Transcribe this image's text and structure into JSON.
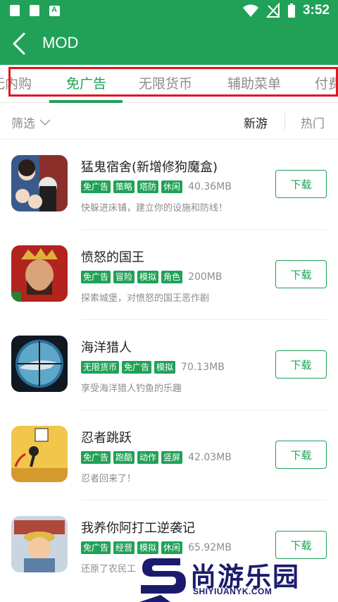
{
  "status_bar": {
    "time": "3:52",
    "left_icons": [
      "lock-icon",
      "map-icon",
      "a-app-icon"
    ],
    "right_icons": [
      "wifi-icon",
      "no-signal-icon",
      "battery-icon"
    ]
  },
  "app_bar": {
    "title": "MOD",
    "back_icon": "back-arrow-icon"
  },
  "tabs": [
    {
      "label": "无内购",
      "active": false
    },
    {
      "label": "免广告",
      "active": true
    },
    {
      "label": "无限货币",
      "active": false
    },
    {
      "label": "辅助菜单",
      "active": false
    },
    {
      "label": "付费",
      "active": false
    }
  ],
  "filter": {
    "label": "筛选",
    "sort_new": "新游",
    "sort_hot": "热门"
  },
  "apps": [
    {
      "name": "猛鬼宿舍(新增修狗魔盒)",
      "tags": [
        "免广告",
        "策略",
        "塔防",
        "休闲"
      ],
      "size": "40.36MB",
      "desc": "快躲进床铺，建立你的设施和防线！",
      "button": "下载"
    },
    {
      "name": "愤怒的国王",
      "tags": [
        "免广告",
        "冒险",
        "模拟",
        "角色"
      ],
      "size": "200MB",
      "desc": "探索城堡，对愤怒的国王恶作剧",
      "button": "下载"
    },
    {
      "name": "海洋猎人",
      "tags": [
        "无限货币",
        "免广告",
        "模拟"
      ],
      "size": "70.13MB",
      "desc": "享受海洋猎人钓鱼的乐趣",
      "button": "下载"
    },
    {
      "name": "忍者跳跃",
      "tags": [
        "免广告",
        "跑酷",
        "动作",
        "竖屏"
      ],
      "size": "42.03MB",
      "desc": "忍者回来了！",
      "button": "下载"
    },
    {
      "name": "我养你阿打工逆袭记",
      "tags": [
        "免广告",
        "经营",
        "模拟",
        "休闲"
      ],
      "size": "65.92MB",
      "desc": "还原了农民工",
      "button": "下载"
    }
  ],
  "watermark": {
    "text": "尚游乐园",
    "url": "SHIYIUANYK.COM"
  },
  "colors": {
    "brand_green": "#20a157",
    "highlight_red": "#e0141e",
    "watermark_navy": "#1b1b6e"
  }
}
